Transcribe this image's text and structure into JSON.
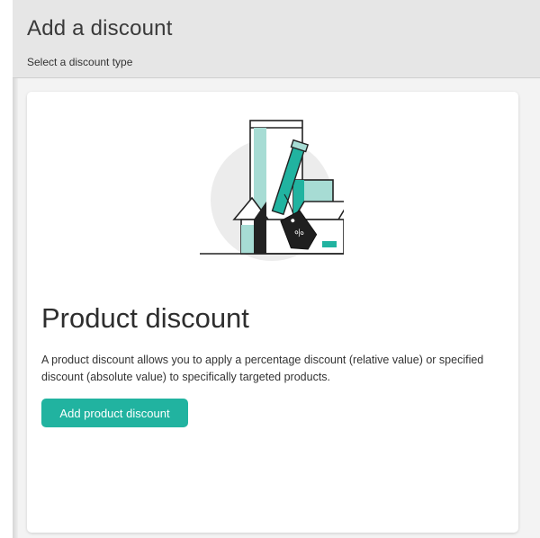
{
  "header": {
    "title": "Add a discount",
    "subtitle": "Select a discount type"
  },
  "card": {
    "illustration_icon": "discount-boxes-illustration",
    "tag_label": "%",
    "title": "Product discount",
    "description": "A product discount allows you to apply a percentage discount (relative value) or specified discount (absolute value) to specifically targeted products.",
    "button_label": "Add product discount"
  },
  "colors": {
    "accent": "#21b3a0",
    "header_bg": "#e6e6e6",
    "content_bg": "#f3f3f3"
  }
}
